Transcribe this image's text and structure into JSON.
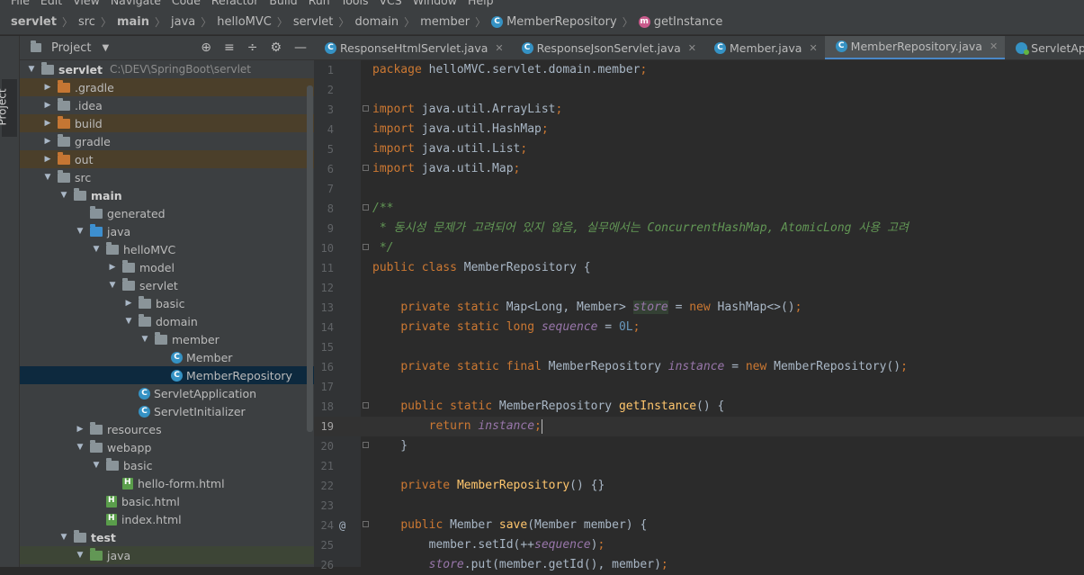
{
  "menu": [
    "File",
    "Edit",
    "View",
    "Navigate",
    "Code",
    "Refactor",
    "Build",
    "Run",
    "Tools",
    "VCS",
    "Window",
    "Help"
  ],
  "breadcrumb": [
    "servlet",
    "src",
    "main",
    "java",
    "helloMVC",
    "servlet",
    "domain",
    "member",
    "MemberRepository",
    "getInstance"
  ],
  "toolwindow": {
    "label": "Project"
  },
  "project": {
    "title": "Project",
    "tree": [
      {
        "label": "servlet",
        "path": "C:\\DEV\\SpringBoot\\servlet",
        "depth": 0,
        "expanded": true,
        "icon": "folder-gray",
        "bold": true
      },
      {
        "label": ".gradle",
        "depth": 1,
        "expanded": false,
        "icon": "folder-orange",
        "highlight": true
      },
      {
        "label": ".idea",
        "depth": 1,
        "expanded": false,
        "icon": "folder-gray"
      },
      {
        "label": "build",
        "depth": 1,
        "expanded": false,
        "icon": "folder-orange",
        "highlight": true
      },
      {
        "label": "gradle",
        "depth": 1,
        "expanded": false,
        "icon": "folder-gray"
      },
      {
        "label": "out",
        "depth": 1,
        "expanded": false,
        "icon": "folder-orange",
        "highlight": true
      },
      {
        "label": "src",
        "depth": 1,
        "expanded": true,
        "icon": "folder-gray"
      },
      {
        "label": "main",
        "depth": 2,
        "expanded": true,
        "icon": "folder-gray",
        "bold": true
      },
      {
        "label": "generated",
        "depth": 3,
        "icon": "folder-light"
      },
      {
        "label": "java",
        "depth": 3,
        "expanded": true,
        "icon": "folder-blue"
      },
      {
        "label": "helloMVC",
        "depth": 4,
        "expanded": true,
        "icon": "folder-gray"
      },
      {
        "label": "model",
        "depth": 5,
        "expanded": false,
        "icon": "folder-gray"
      },
      {
        "label": "servlet",
        "depth": 5,
        "expanded": true,
        "icon": "folder-gray"
      },
      {
        "label": "basic",
        "depth": 6,
        "expanded": false,
        "icon": "folder-gray"
      },
      {
        "label": "domain",
        "depth": 6,
        "expanded": true,
        "icon": "folder-gray"
      },
      {
        "label": "member",
        "depth": 7,
        "expanded": true,
        "icon": "folder-gray"
      },
      {
        "label": "Member",
        "depth": 8,
        "icon": "class"
      },
      {
        "label": "MemberRepository",
        "depth": 8,
        "icon": "class",
        "selected": true
      },
      {
        "label": "ServletApplication",
        "depth": 6,
        "icon": "class-spring"
      },
      {
        "label": "ServletInitializer",
        "depth": 6,
        "icon": "class"
      },
      {
        "label": "resources",
        "depth": 3,
        "expanded": false,
        "icon": "folder-gray"
      },
      {
        "label": "webapp",
        "depth": 3,
        "expanded": true,
        "icon": "folder-gray"
      },
      {
        "label": "basic",
        "depth": 4,
        "expanded": true,
        "icon": "folder-gray"
      },
      {
        "label": "hello-form.html",
        "depth": 5,
        "icon": "html"
      },
      {
        "label": "basic.html",
        "depth": 4,
        "icon": "html"
      },
      {
        "label": "index.html",
        "depth": 4,
        "icon": "html"
      },
      {
        "label": "test",
        "depth": 2,
        "expanded": true,
        "icon": "folder-gray",
        "bold": true
      },
      {
        "label": "java",
        "depth": 3,
        "expanded": true,
        "icon": "folder-green",
        "test": true
      }
    ]
  },
  "tabs": [
    {
      "label": "ResponseHtmlServlet.java",
      "icon": "class",
      "active": false
    },
    {
      "label": "ResponseJsonServlet.java",
      "icon": "class",
      "active": false
    },
    {
      "label": "Member.java",
      "icon": "class",
      "active": false
    },
    {
      "label": "MemberRepository.java",
      "icon": "class",
      "active": true
    },
    {
      "label": "ServletApplication.java",
      "icon": "class-spring",
      "active": false
    }
  ],
  "editor": {
    "current_line": 19,
    "lines": [
      {
        "n": "1",
        "tokens": [
          [
            "k",
            "package"
          ],
          [
            "p",
            " helloMVC.servlet.domain.member"
          ],
          [
            "k",
            ";"
          ]
        ]
      },
      {
        "n": "2",
        "tokens": []
      },
      {
        "n": "3",
        "fold": true,
        "tokens": [
          [
            "k",
            "import"
          ],
          [
            "p",
            " java.util.ArrayList"
          ],
          [
            "k",
            ";"
          ]
        ]
      },
      {
        "n": "4",
        "tokens": [
          [
            "k",
            "import"
          ],
          [
            "p",
            " java.util.HashMap"
          ],
          [
            "k",
            ";"
          ]
        ]
      },
      {
        "n": "5",
        "tokens": [
          [
            "k",
            "import"
          ],
          [
            "p",
            " java.util.List"
          ],
          [
            "k",
            ";"
          ]
        ]
      },
      {
        "n": "6",
        "fold": true,
        "tokens": [
          [
            "k",
            "import"
          ],
          [
            "p",
            " java.util.Map"
          ],
          [
            "k",
            ";"
          ]
        ]
      },
      {
        "n": "7",
        "tokens": []
      },
      {
        "n": "8",
        "fold": true,
        "tokens": [
          [
            "c",
            "/**"
          ]
        ]
      },
      {
        "n": "9",
        "tokens": [
          [
            "c",
            " * 동시성 문제가 고려되어 있지 않음, 실무에서는 ConcurrentHashMap, AtomicLong 사용 고려"
          ]
        ]
      },
      {
        "n": "10",
        "fold": true,
        "tokens": [
          [
            "c",
            " */"
          ]
        ]
      },
      {
        "n": "11",
        "tokens": [
          [
            "k",
            "public class"
          ],
          [
            "p",
            " MemberRepository {"
          ]
        ]
      },
      {
        "n": "12",
        "tokens": []
      },
      {
        "n": "13",
        "tokens": [
          [
            "p",
            "    "
          ],
          [
            "k",
            "private static"
          ],
          [
            "p",
            " Map<Long, Member> "
          ],
          [
            "fr",
            "store"
          ],
          [
            "p",
            " = "
          ],
          [
            "k",
            "new"
          ],
          [
            "p",
            " HashMap<>()"
          ],
          [
            "k",
            ";"
          ]
        ]
      },
      {
        "n": "14",
        "tokens": [
          [
            "p",
            "    "
          ],
          [
            "k",
            "private static long"
          ],
          [
            "p",
            " "
          ],
          [
            "f",
            "sequence"
          ],
          [
            "p",
            " = "
          ],
          [
            "n",
            "0L"
          ],
          [
            "k",
            ";"
          ]
        ]
      },
      {
        "n": "15",
        "tokens": []
      },
      {
        "n": "16",
        "tokens": [
          [
            "p",
            "    "
          ],
          [
            "k",
            "private static final"
          ],
          [
            "p",
            " MemberRepository "
          ],
          [
            "f",
            "instance"
          ],
          [
            "p",
            " = "
          ],
          [
            "k",
            "new"
          ],
          [
            "p",
            " MemberRepository()"
          ],
          [
            "k",
            ";"
          ]
        ]
      },
      {
        "n": "17",
        "tokens": []
      },
      {
        "n": "18",
        "fold": true,
        "tokens": [
          [
            "p",
            "    "
          ],
          [
            "k",
            "public static"
          ],
          [
            "p",
            " MemberRepository "
          ],
          [
            "m",
            "getInstance"
          ],
          [
            "p",
            "() {"
          ]
        ]
      },
      {
        "n": "19",
        "tokens": [
          [
            "p",
            "        "
          ],
          [
            "k",
            "return"
          ],
          [
            "p",
            " "
          ],
          [
            "f",
            "instance"
          ],
          [
            "k",
            ";"
          ],
          [
            "caret",
            ""
          ]
        ]
      },
      {
        "n": "20",
        "fold": true,
        "tokens": [
          [
            "p",
            "    }"
          ]
        ]
      },
      {
        "n": "21",
        "tokens": []
      },
      {
        "n": "22",
        "tokens": [
          [
            "p",
            "    "
          ],
          [
            "k",
            "private"
          ],
          [
            "p",
            " "
          ],
          [
            "m",
            "MemberRepository"
          ],
          [
            "p",
            "() {}"
          ]
        ]
      },
      {
        "n": "23",
        "tokens": []
      },
      {
        "n": "24",
        "mark": "@",
        "fold": true,
        "tokens": [
          [
            "p",
            "    "
          ],
          [
            "k",
            "public"
          ],
          [
            "p",
            " Member "
          ],
          [
            "m",
            "save"
          ],
          [
            "p",
            "(Member member) {"
          ]
        ]
      },
      {
        "n": "25",
        "tokens": [
          [
            "p",
            "        member.setId(++"
          ],
          [
            "f",
            "sequence"
          ],
          [
            "p",
            ")"
          ],
          [
            "k",
            ";"
          ]
        ]
      },
      {
        "n": "26",
        "tokens": [
          [
            "p",
            "        "
          ],
          [
            "f",
            "store"
          ],
          [
            "p",
            ".put(member.getId(), member)"
          ],
          [
            "k",
            ";"
          ]
        ]
      }
    ]
  }
}
